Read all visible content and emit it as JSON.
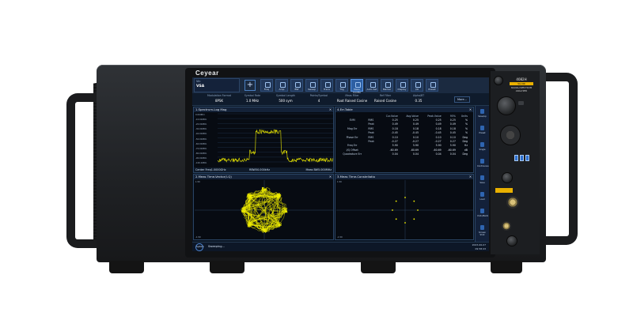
{
  "brand": "Ceyear",
  "model": {
    "number": "4082H",
    "tag": "5G NR",
    "subtitle": "SIGNAL/SPECTRUM ANALYZER"
  },
  "toolbar": {
    "mode_label": "Vin",
    "mode_value": "VSA",
    "buttons": [
      "Freq",
      "Amp",
      "BW",
      "Sweep",
      "Trace",
      "Trig",
      "Meas Config",
      "Auto Set",
      "Marker",
      "Display",
      "I/O",
      "Preset"
    ],
    "highlighted": "Meas Config"
  },
  "params": [
    {
      "label": "Modulation Format",
      "value": "8PSK"
    },
    {
      "label": "Symbol Rate",
      "value": "1.0 MHz"
    },
    {
      "label": "Symbol Length",
      "value": "500 sym"
    },
    {
      "label": "Points/Symbol",
      "value": "4"
    },
    {
      "label": "Meas Filter",
      "value": "Root Raised Cosine"
    },
    {
      "label": "Ref Filter",
      "value": "Raised Cosine"
    },
    {
      "label": "Alpha/BT",
      "value": "0.35"
    }
  ],
  "more_label": "More...",
  "windows": {
    "spectrum": {
      "title": "1.Spectrum-Log Mag",
      "y_ticks": [
        "0.00dBm",
        "-10.00dBm",
        "-20.00dBm",
        "-30.00dBm",
        "-40.00dBm",
        "-50.00dBm",
        "-60.00dBm",
        "-70.00dBm",
        "-80.00dBm",
        "-90.00dBm",
        "-100.0dBm"
      ],
      "center": "Center Freq1.0000GHz",
      "rbw": "RBW50.000kHz",
      "meas_bw": "Meas BW5.000MHz"
    },
    "err_table": {
      "title": "4.Err.Table",
      "headers": [
        "",
        "",
        "Cur.Value",
        "Avg.Value",
        "Peak.Value",
        "95%",
        "Units"
      ],
      "rows": [
        {
          "group": "EVM",
          "sub": "RMS",
          "vals": [
            "0.25",
            "0.25",
            "0.25",
            "0.25",
            "%"
          ]
        },
        {
          "group": "",
          "sub": "Peak",
          "vals": [
            "0.49",
            "0.49",
            "0.49",
            "0.49",
            "%"
          ]
        },
        {
          "group": "Mag Err",
          "sub": "RMS",
          "vals": [
            "0.18",
            "0.18",
            "0.18",
            "0.18",
            "%"
          ]
        },
        {
          "group": "",
          "sub": "Peak",
          "vals": [
            "-0.45",
            "-0.45",
            "-0.45",
            "0.45",
            "%"
          ]
        },
        {
          "group": "Phase Err",
          "sub": "RMS",
          "vals": [
            "0.10",
            "0.10",
            "0.10",
            "0.10",
            "Deg"
          ]
        },
        {
          "group": "",
          "sub": "Peak",
          "vals": [
            "-0.27",
            "-0.27",
            "-0.27",
            "0.27",
            "Deg"
          ]
        },
        {
          "group": "Freq Err",
          "sub": "",
          "vals": [
            "5.90",
            "5.90",
            "5.90",
            "5.90",
            "Hz"
          ]
        },
        {
          "group": "I/Q Offset",
          "sub": "",
          "vals": [
            "-60.69",
            "-60.69",
            "-60.69",
            "-60.69",
            "dB"
          ]
        },
        {
          "group": "Quadrature Err",
          "sub": "",
          "vals": [
            "0.04",
            "0.04",
            "0.04",
            "0.04",
            "Deg"
          ]
        }
      ]
    },
    "vector": {
      "title": "2.Meas Time-Vector(I-Q)",
      "y_top": "1.50",
      "y_bottom": "-1.50"
    },
    "constellation": {
      "title": "3.Meas Time-Constellatio",
      "y_top": "1.50",
      "y_bottom": "-1.50"
    }
  },
  "right_bar": [
    "Save/up",
    "Preset",
    "Single",
    "Continuous",
    "Save",
    "Load",
    "Undo/Redo",
    "Screen Shot"
  ],
  "status": {
    "system_label": "System",
    "sweep_text": "Sweeping...",
    "date": "2023-06-07",
    "time": "09:58:43"
  },
  "accent": "#2d5fa3",
  "trace_color": "#f3f000"
}
